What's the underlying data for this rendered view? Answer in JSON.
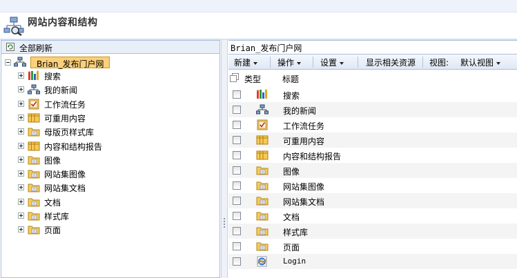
{
  "header": {
    "title": "网站内容和结构"
  },
  "left": {
    "refresh_label": "全部刷新",
    "root_label": "Brian_发布门户网",
    "items": [
      {
        "label": "搜索",
        "icon": "search-app-icon"
      },
      {
        "label": "我的新闻",
        "icon": "site-icon"
      },
      {
        "label": "工作流任务",
        "icon": "task-list-icon"
      },
      {
        "label": "可重用内容",
        "icon": "list-icon"
      },
      {
        "label": "母版页样式库",
        "icon": "folder-icon"
      },
      {
        "label": "内容和结构报告",
        "icon": "list-icon"
      },
      {
        "label": "图像",
        "icon": "folder-icon"
      },
      {
        "label": "网站集图像",
        "icon": "folder-icon"
      },
      {
        "label": "网站集文档",
        "icon": "folder-icon"
      },
      {
        "label": "文档",
        "icon": "folder-icon"
      },
      {
        "label": "样式库",
        "icon": "folder-icon"
      },
      {
        "label": "页面",
        "icon": "folder-icon"
      }
    ]
  },
  "right": {
    "breadcrumb": "Brian_发布门户网",
    "toolbar": {
      "new_label": "新建",
      "actions_label": "操作",
      "settings_label": "设置",
      "show_resources_label": "显示相关资源",
      "view_prefix": "视图:",
      "view_label": "默认视图"
    },
    "columns": {
      "type": "类型",
      "title": "标题"
    },
    "rows": [
      {
        "title": "搜索",
        "icon": "search-app-icon"
      },
      {
        "title": "我的新闻",
        "icon": "site-icon"
      },
      {
        "title": "工作流任务",
        "icon": "task-list-icon"
      },
      {
        "title": "可重用内容",
        "icon": "list-icon"
      },
      {
        "title": "内容和结构报告",
        "icon": "list-icon"
      },
      {
        "title": "图像",
        "icon": "folder-icon"
      },
      {
        "title": "网站集图像",
        "icon": "folder-icon"
      },
      {
        "title": "网站集文档",
        "icon": "folder-icon"
      },
      {
        "title": "文档",
        "icon": "folder-icon"
      },
      {
        "title": "样式库",
        "icon": "folder-icon"
      },
      {
        "title": "页面",
        "icon": "folder-icon"
      },
      {
        "title": "Login",
        "icon": "ie-link-icon"
      }
    ]
  },
  "colors": {
    "selection": "#fbd07a",
    "panel_border": "#a7bedc",
    "toolbar_bg": "#dfe8f4"
  }
}
